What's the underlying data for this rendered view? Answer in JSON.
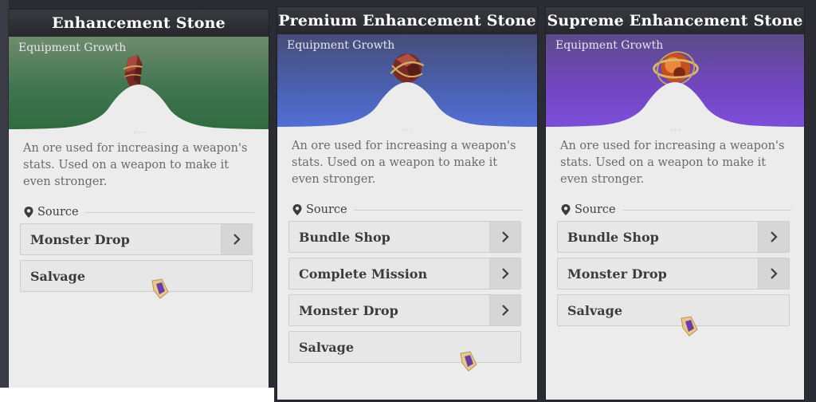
{
  "cards": [
    {
      "title": "Enhancement Stone",
      "category": "Equipment Growth",
      "description": "An ore used for increasing a weapon's stats. Used on a weapon to make it even stronger.",
      "source_label": "Source",
      "sources": [
        {
          "label": "Monster Drop",
          "navigable": true
        },
        {
          "label": "Salvage",
          "navigable": false
        }
      ],
      "theme": "green",
      "header_color": "#3f7450"
    },
    {
      "title": "Premium Enhancement Stone",
      "category": "Equipment Growth",
      "description": "An ore used for increasing a weapon's stats. Used on a weapon to make it even stronger.",
      "source_label": "Source",
      "sources": [
        {
          "label": "Bundle Shop",
          "navigable": true
        },
        {
          "label": "Complete Mission",
          "navigable": true
        },
        {
          "label": "Monster Drop",
          "navigable": true
        },
        {
          "label": "Salvage",
          "navigable": false
        }
      ],
      "theme": "blue",
      "header_color": "#4a62b4"
    },
    {
      "title": "Supreme Enhancement Stone",
      "category": "Equipment Growth",
      "description": "An ore used for increasing a weapon's stats. Used on a weapon to make it even stronger.",
      "source_label": "Source",
      "sources": [
        {
          "label": "Bundle Shop",
          "navigable": true
        },
        {
          "label": "Monster Drop",
          "navigable": true
        },
        {
          "label": "Salvage",
          "navigable": false
        }
      ],
      "theme": "purple",
      "header_color": "#7446c6"
    }
  ],
  "icons": {
    "location": "map-pin-icon",
    "navigate": "chevron-right-icon",
    "cursor": "crystal-cursor-icon",
    "item": "ore-stone-icon"
  }
}
